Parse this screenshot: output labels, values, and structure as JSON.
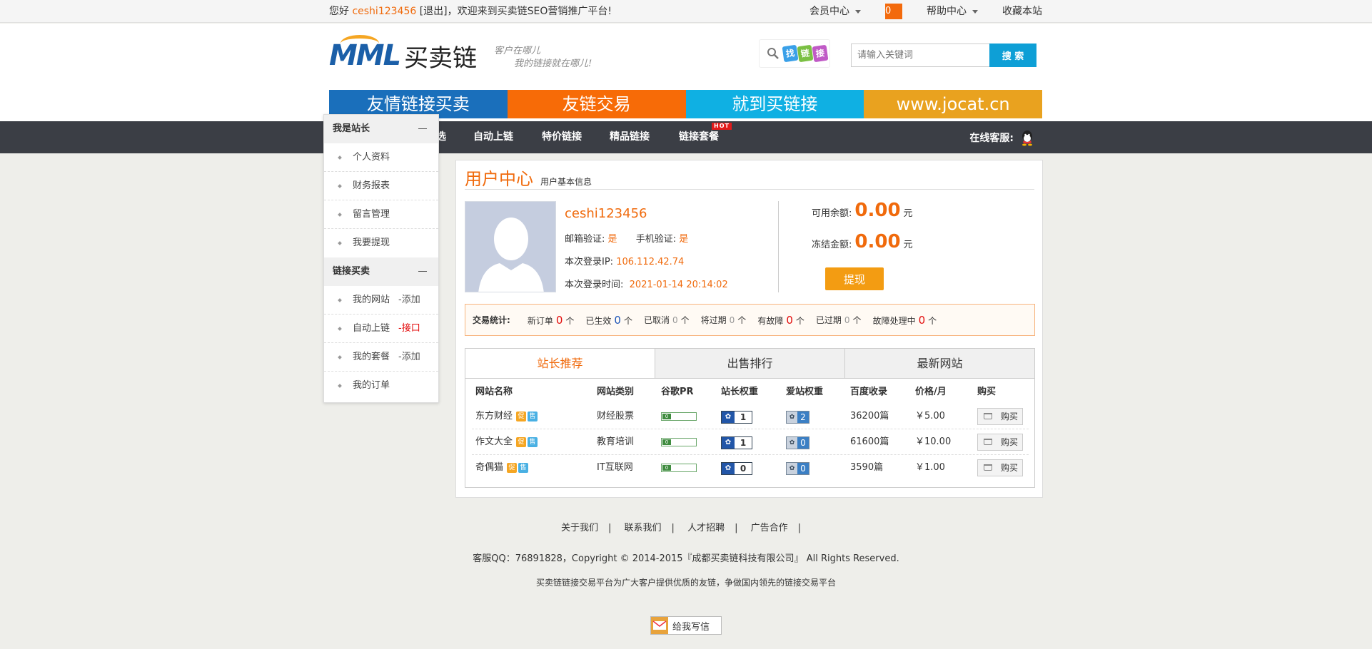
{
  "topbar": {
    "greeting_prefix": "您好",
    "username": "ceshi123456",
    "logout": "[退出]",
    "greeting_suffix": "，欢迎来到买卖链SEO营销推广平台!",
    "member_center": "会员中心",
    "cart_count": "0",
    "help_center": "帮助中心",
    "bookmark": "收藏本站"
  },
  "header": {
    "logo_mark": "MML",
    "logo_cn": "买卖链",
    "slogan_line1": "客户在哪儿",
    "slogan_line2": "我的链接就在哪儿!",
    "find_chars": [
      "找",
      "链",
      "接"
    ],
    "search_placeholder": "请输入关键词",
    "search_button": "搜 索"
  },
  "banner": [
    "友情链接买卖",
    "友链交易",
    "就到买链接",
    "www.jocat.cn"
  ],
  "nav": {
    "items": [
      "选",
      "自动上链",
      "特价链接",
      "精品链接",
      "链接套餐"
    ],
    "hot": "HOT",
    "online_service": "在线客服:"
  },
  "sidebar": {
    "section1": "我是站长",
    "s1_items": [
      "个人资料",
      "财务报表",
      "留言管理",
      "我要提现"
    ],
    "section2": "链接买卖",
    "s2_items": [
      {
        "label": "我的网站",
        "extra": "-添加"
      },
      {
        "label": "自动上链",
        "extra": "-接口"
      },
      {
        "label": "我的套餐",
        "extra": "-添加"
      },
      {
        "label": "我的订单",
        "extra": ""
      }
    ]
  },
  "main": {
    "title": "用户中心",
    "subtitle": "用户基本信息",
    "username": "ceshi123456",
    "email_label": "邮箱验证:",
    "email_value": "是",
    "phone_label": "手机验证:",
    "phone_value": "是",
    "ip_label": "本次登录IP:",
    "ip_value": "106.112.42.74",
    "time_label": "本次登录时间:",
    "time_value": "2021-01-14 20:14:02",
    "available_label": "可用余额:",
    "available_value": "0.00",
    "frozen_label": "冻结金额:",
    "frozen_value": "0.00",
    "currency": "元",
    "withdraw_button": "提现"
  },
  "stats": {
    "label": "交易统计:",
    "unit": "个",
    "items": [
      {
        "label": "新订单",
        "value": "0"
      },
      {
        "label": "已生效",
        "value": "0"
      },
      {
        "label": "已取消",
        "value": "0"
      },
      {
        "label": "将过期",
        "value": "0"
      },
      {
        "label": "有故障",
        "value": "0"
      },
      {
        "label": "已过期",
        "value": "0"
      },
      {
        "label": "故障处理中",
        "value": "0"
      }
    ]
  },
  "tabs": [
    "站长推荐",
    "出售排行",
    "最新网站"
  ],
  "table": {
    "headers": [
      "网站名称",
      "网站类别",
      "谷歌PR",
      "站长权重",
      "爱站权重",
      "百度收录",
      "价格/月",
      "购买"
    ],
    "promo_chip": "促",
    "sale_chip": "售",
    "buy_label": "购买",
    "rows": [
      {
        "name": "东方财经",
        "category": "财经股票",
        "pr": 0,
        "weight": "1",
        "aizhan": "2",
        "baidu": "36200篇",
        "price": "￥5.00"
      },
      {
        "name": "作文大全",
        "category": "教育培训",
        "pr": 0,
        "weight": "1",
        "aizhan": "0",
        "baidu": "61600篇",
        "price": "￥10.00"
      },
      {
        "name": "奇偶猫",
        "category": "IT互联网",
        "pr": 0,
        "weight": "0",
        "aizhan": "0",
        "baidu": "3590篇",
        "price": "￥1.00"
      }
    ]
  },
  "footer": {
    "links": [
      "关于我们",
      "联系我们",
      "人才招聘",
      "广告合作"
    ],
    "copyright": "客服QQ：76891828，Copyright © 2014-2015『成都买卖链科技有限公司』 All Rights Reserved.",
    "desc": "买卖链链接交易平台为广大客户提供优质的友链，争做国内领先的链接交易平台",
    "mail": "给我写信"
  },
  "colors": {
    "accent": "#f06a0c",
    "banner": [
      "#1a6fbb",
      "#f76b07",
      "#0fb0e3",
      "#e9a21f"
    ],
    "nav_bg": "#3b3e45",
    "search_btn": "#0e9fd6"
  }
}
